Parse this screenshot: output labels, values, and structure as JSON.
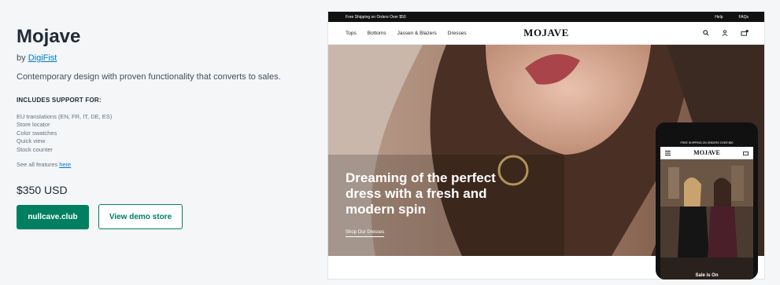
{
  "theme": {
    "title": "Mojave",
    "by_prefix": "by",
    "developer": "DigiFist",
    "tagline": "Contemporary design with proven functionality that converts to sales.",
    "support_heading": "INCLUDES SUPPORT FOR:",
    "features": [
      "EU translations (EN, FR, IT, DE, ES)",
      "Store locator",
      "Color swatches",
      "Quick view",
      "Stock counter"
    ],
    "see_all_prefix": "See all features",
    "see_all_link": "here",
    "price": "$350 USD",
    "primary_button": "nullcave.club",
    "secondary_button": "View demo store"
  },
  "preview": {
    "announcement": "Free Shipping on Orders Over $50",
    "help": "Help",
    "faqs": "FAQs",
    "menu": [
      "Tops",
      "Bottoms",
      "Jassen & Blazers",
      "Dresses"
    ],
    "logo": "MOJAVE",
    "hero_heading": "Dreaming of the perfect dress with a fresh and modern spin",
    "hero_link": "Shop Our Dresses"
  },
  "phone": {
    "announcement": "FREE SHIPPING ON ORDERS OVER $50",
    "logo": "MOJAVE",
    "sale_text": "Sale is On"
  },
  "colors": {
    "accent": "#008060",
    "link": "#007ace",
    "background": "#f4f6f8"
  }
}
